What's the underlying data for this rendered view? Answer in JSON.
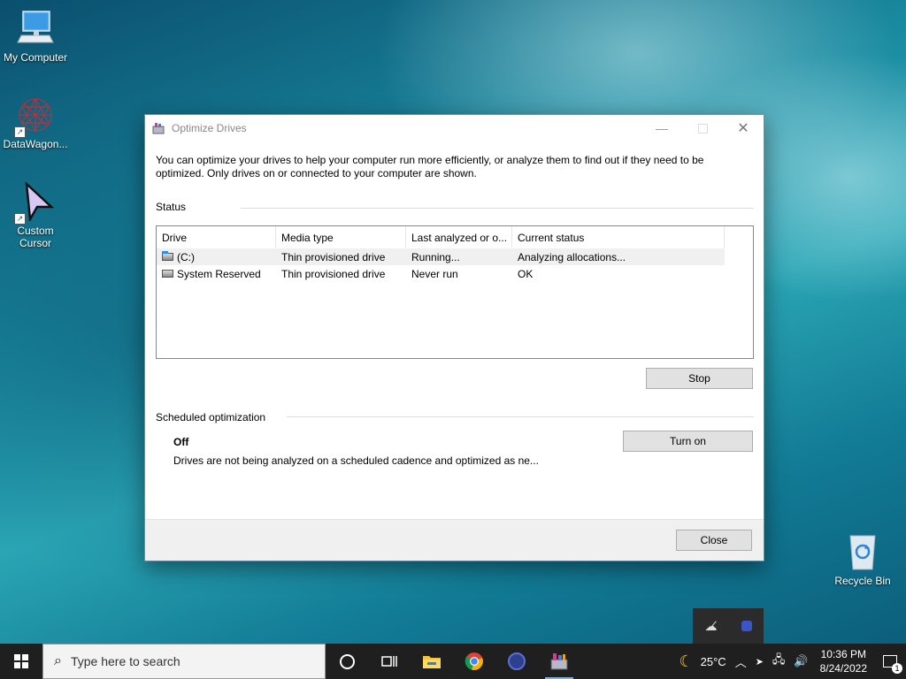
{
  "desktop": {
    "icons": [
      {
        "label": "My Computer"
      },
      {
        "label": "DataWagon..."
      },
      {
        "label": "Custom Cursor"
      },
      {
        "label": "Recycle Bin"
      }
    ]
  },
  "dialog": {
    "title": "Optimize Drives",
    "description": "You can optimize your drives to help your computer run more efficiently, or analyze them to find out if they need to be optimized. Only drives on or connected to your computer are shown.",
    "status_label": "Status",
    "columns": [
      "Drive",
      "Media type",
      "Last analyzed or o...",
      "Current status"
    ],
    "drives": [
      {
        "drive": "(C:)",
        "media": "Thin provisioned drive",
        "last": "Running...",
        "status": "Analyzing allocations..."
      },
      {
        "drive": "System Reserved",
        "media": "Thin provisioned drive",
        "last": "Never run",
        "status": "OK"
      }
    ],
    "stop_label": "Stop",
    "scheduled_label": "Scheduled optimization",
    "scheduled_state": "Off",
    "scheduled_desc": "Drives are not being analyzed on a scheduled cadence and optimized as ne...",
    "turn_on_label": "Turn on",
    "close_label": "Close"
  },
  "taskbar": {
    "search_placeholder": "Type here to search",
    "weather": "25°C",
    "time": "10:36 PM",
    "date": "8/24/2022",
    "notification_count": "1"
  }
}
